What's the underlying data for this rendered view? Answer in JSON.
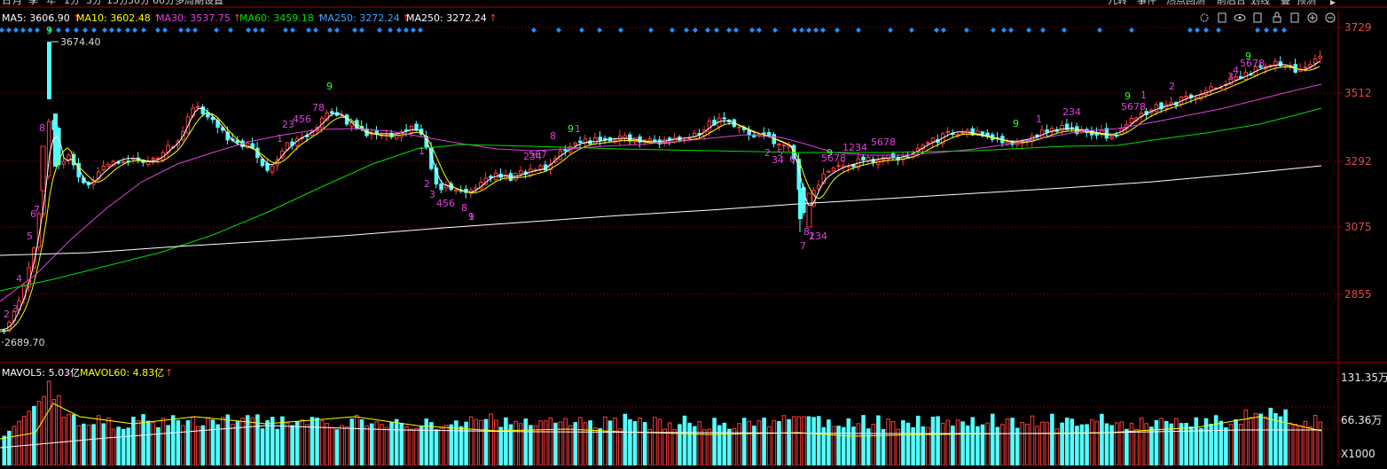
{
  "toolbar": {
    "timeframes": [
      "日",
      "月",
      "季",
      "年",
      "1分",
      "5分",
      "15分",
      "30分",
      "60分",
      "多周期",
      "设置"
    ],
    "right_tools": [
      "九转",
      "事件",
      "热点回测",
      "前后台",
      "划线",
      "叠",
      "预测"
    ],
    "icons": [
      "settings-icon",
      "brush-icon",
      "eye-icon",
      "hand-icon",
      "lock-icon",
      "copy-icon",
      "zoom-in-icon",
      "zoom-out-icon"
    ]
  },
  "ma_legend": [
    {
      "label": "MA5: 3606.90",
      "arrow": "↑",
      "color": "#ffffff"
    },
    {
      "label": "MA10: 3602.48",
      "arrow": "↑",
      "color": "#ffff00"
    },
    {
      "label": "MA30: 3537.75",
      "arrow": "↑",
      "color": "#e040e0"
    },
    {
      "label": "MA60: 3459.18",
      "arrow": "↑",
      "color": "#00e000"
    },
    {
      "label": "MA250: 3272.24",
      "arrow": "↑",
      "color": "#40a0ff"
    },
    {
      "label": "MA250: 3272.24",
      "arrow": "↑",
      "color": "#ffffff"
    }
  ],
  "price_axis": [
    "3729",
    "3512",
    "3292",
    "3075",
    "2855"
  ],
  "volume_axis": [
    "131.35万",
    "66.36万",
    "X1000"
  ],
  "volume_legend": {
    "mavol5": "MAVOL5: 5.03亿",
    "mavol5_arrow": "↓",
    "mavol60": "MAVOL60: 4.83亿",
    "mavol60_arrow": "↑"
  },
  "high_label": "3674.40",
  "low_label": "2689.70",
  "colors": {
    "up": "#ff3b3b",
    "down": "#54ffff",
    "grid": "#7a0000",
    "ma5": "#ffffff",
    "ma10": "#ffff00",
    "ma30": "#e040e0",
    "ma60": "#00e000",
    "ma250": "#ffffff",
    "seq_up": "#e040e0",
    "seq_nine": "#30ff30",
    "signal": "#1e90ff"
  },
  "td_sequences": [
    {
      "digits": "2",
      "color": "magenta"
    },
    {
      "digits": "3",
      "color": "magenta"
    },
    {
      "digits": "4",
      "color": "magenta"
    },
    {
      "digits": "5",
      "color": "magenta"
    },
    {
      "digits": "6",
      "color": "magenta"
    },
    {
      "digits": "7",
      "color": "magenta"
    },
    {
      "digits": "8",
      "color": "magenta"
    },
    {
      "digits": "9",
      "color": "green"
    },
    {
      "digits": "9",
      "color": "green"
    },
    {
      "digits": "1",
      "color": "magenta"
    },
    {
      "digits": "23",
      "color": "magenta"
    },
    {
      "digits": "456",
      "color": "magenta"
    },
    {
      "digits": "78",
      "color": "magenta"
    },
    {
      "digits": "1",
      "color": "magenta"
    },
    {
      "digits": "2",
      "color": "magenta"
    },
    {
      "digits": "3",
      "color": "magenta"
    },
    {
      "digits": "456",
      "color": "magenta"
    },
    {
      "digits": "8",
      "color": "magenta"
    },
    {
      "digits": "9",
      "color": "magenta"
    },
    {
      "digits": "1",
      "color": "magenta"
    },
    {
      "digits": "234",
      "color": "magenta"
    },
    {
      "digits": "567",
      "color": "magenta"
    },
    {
      "digits": "8",
      "color": "magenta"
    },
    {
      "digits": "9",
      "color": "green"
    },
    {
      "digits": "1",
      "color": "magenta"
    },
    {
      "digits": "2",
      "color": "magenta"
    },
    {
      "digits": "34",
      "color": "magenta"
    },
    {
      "digits": "5",
      "color": "magenta"
    },
    {
      "digits": "6",
      "color": "magenta"
    },
    {
      "digits": "7",
      "color": "magenta"
    },
    {
      "digits": "8",
      "color": "magenta"
    },
    {
      "digits": "1",
      "color": "magenta"
    },
    {
      "digits": "234",
      "color": "magenta"
    },
    {
      "digits": "5678",
      "color": "magenta"
    },
    {
      "digits": "9",
      "color": "green"
    },
    {
      "digits": "1234",
      "color": "magenta"
    },
    {
      "digits": "5678",
      "color": "magenta"
    },
    {
      "digits": "9",
      "color": "green"
    },
    {
      "digits": "1",
      "color": "magenta"
    },
    {
      "digits": "234",
      "color": "magenta"
    },
    {
      "digits": "5678",
      "color": "magenta"
    },
    {
      "digits": "9",
      "color": "green"
    },
    {
      "digits": "1",
      "color": "magenta"
    },
    {
      "digits": "2",
      "color": "magenta"
    },
    {
      "digits": "3",
      "color": "magenta"
    },
    {
      "digits": "4",
      "color": "magenta"
    },
    {
      "digits": "5678",
      "color": "magenta"
    },
    {
      "digits": "9",
      "color": "green"
    }
  ],
  "chart_data": {
    "type": "candlestick",
    "price_range": [
      2689.7,
      3729
    ],
    "ma_series": [
      "MA5",
      "MA10",
      "MA30",
      "MA60",
      "MA250"
    ],
    "ma_last": {
      "MA5": 3606.9,
      "MA10": 3602.48,
      "MA30": 3537.75,
      "MA60": 3459.18,
      "MA250": 3272.24
    },
    "price_high": 3674.4,
    "price_low": 2689.7,
    "volume_unit": "X1000",
    "volume_ticks": [
      "131.35万",
      "66.36万"
    ]
  }
}
